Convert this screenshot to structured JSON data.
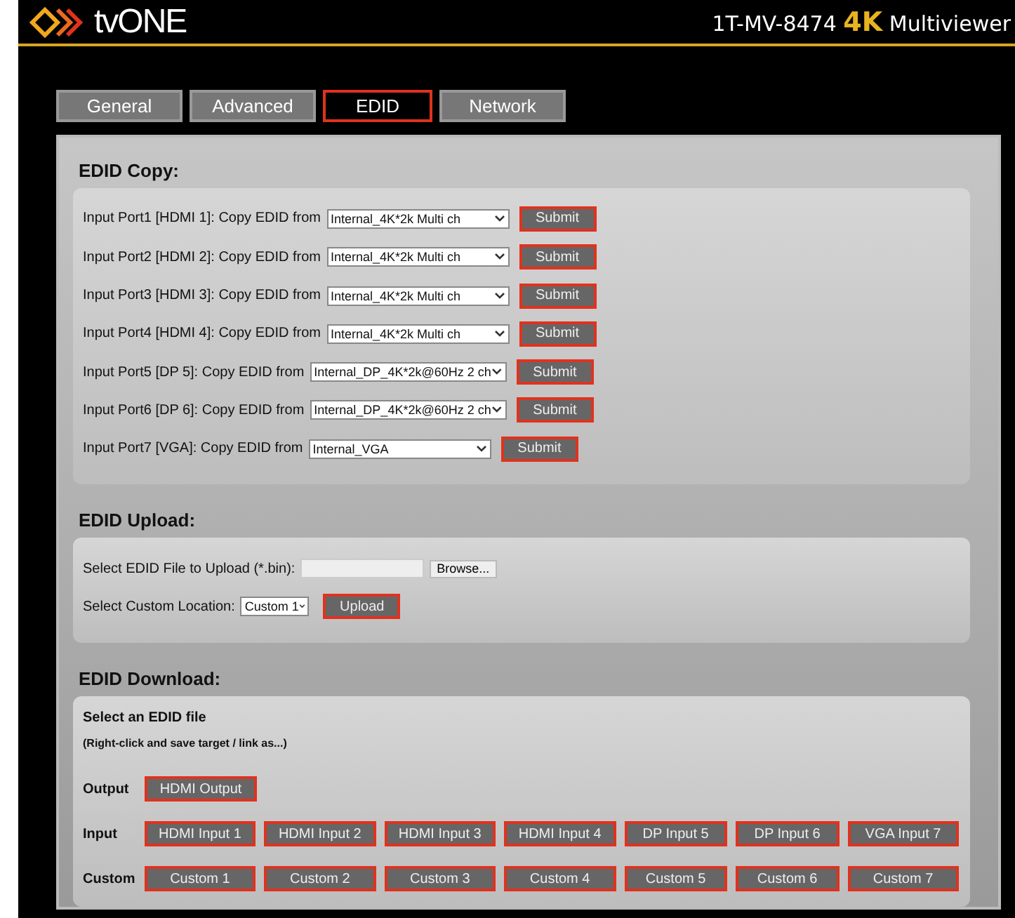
{
  "header": {
    "brand": "tvONE",
    "model": "1T-MV-8474",
    "model_highlight": "4K",
    "product": "Multiviewer"
  },
  "tabs": [
    {
      "label": "General",
      "selected": false
    },
    {
      "label": "Advanced",
      "selected": false
    },
    {
      "label": "EDID",
      "selected": true
    },
    {
      "label": "Network",
      "selected": false
    }
  ],
  "edid_copy": {
    "title": "EDID Copy:",
    "rows": [
      {
        "label": "Input Port1 [HDMI 1]: Copy EDID from",
        "value": "Internal_4K*2k Multi ch",
        "button": "Submit"
      },
      {
        "label": "Input Port2 [HDMI 2]: Copy EDID from",
        "value": "Internal_4K*2k Multi ch",
        "button": "Submit"
      },
      {
        "label": "Input Port3 [HDMI 3]: Copy EDID from",
        "value": "Internal_4K*2k Multi ch",
        "button": "Submit"
      },
      {
        "label": "Input Port4 [HDMI 4]: Copy EDID from",
        "value": "Internal_4K*2k Multi ch",
        "button": "Submit"
      },
      {
        "label": "Input Port5 [DP 5]: Copy EDID from",
        "value": "Internal_DP_4K*2k@60Hz 2 ch",
        "button": "Submit"
      },
      {
        "label": "Input Port6 [DP 6]: Copy EDID from",
        "value": "Internal_DP_4K*2k@60Hz 2 ch",
        "button": "Submit"
      },
      {
        "label": "Input Port7 [VGA]: Copy EDID from",
        "value": "Internal_VGA",
        "button": "Submit"
      }
    ]
  },
  "edid_upload": {
    "title": "EDID Upload:",
    "file_label": "Select EDID File to Upload (*.bin):",
    "browse": "Browse...",
    "location_label": "Select Custom Location:",
    "location_value": "Custom 1",
    "button": "Upload"
  },
  "edid_download": {
    "title": "EDID Download:",
    "heading": "Select an EDID file",
    "hint": "(Right-click and save target / link as...)",
    "rows": [
      {
        "label": "Output",
        "buttons": [
          "HDMI Output"
        ]
      },
      {
        "label": "Input",
        "buttons": [
          "HDMI Input 1",
          "HDMI Input 2",
          "HDMI Input 3",
          "HDMI Input 4",
          "DP Input 5",
          "DP Input 6",
          "VGA Input 7"
        ]
      },
      {
        "label": "Custom",
        "buttons": [
          "Custom 1",
          "Custom 2",
          "Custom 3",
          "Custom 4",
          "Custom 5",
          "Custom 6",
          "Custom 7"
        ]
      }
    ]
  }
}
